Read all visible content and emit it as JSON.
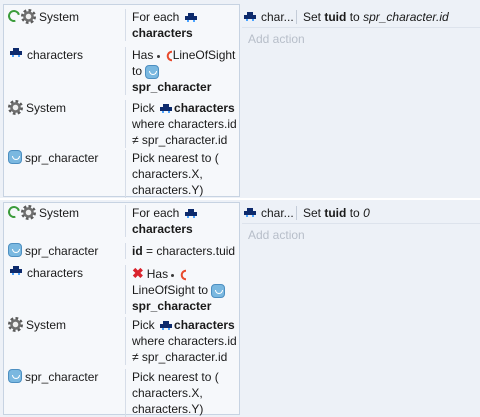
{
  "events": [
    {
      "conditions": [
        {
          "object_label": "System",
          "object_icons": [
            "loop-icon",
            "gear-icon"
          ],
          "text": {
            "prefix": "For each",
            "object": "characters"
          }
        },
        {
          "object_label": "characters",
          "object_icons": [
            "invader-icon"
          ],
          "text": {
            "prefix": "Has",
            "condition_name": "LineOfSight",
            "to_word": "to",
            "target": "spr_character"
          }
        },
        {
          "object_label": "System",
          "object_icons": [
            "gear-icon"
          ],
          "text": {
            "prefix": "Pick",
            "object": "characters",
            "line2": "where characters.id",
            "line3": "≠ spr_character.id"
          }
        },
        {
          "object_label": "spr_character",
          "object_icons": [
            "sprite-icon"
          ],
          "text": {
            "line1": "Pick nearest to (",
            "line2": "characters.X,",
            "line3": "characters.Y)"
          }
        }
      ],
      "action": {
        "object_label": "char...",
        "text_prefix": "Set",
        "variable": "tuid",
        "text_mid": "to",
        "value": "spr_character.id"
      },
      "add_action_label": "Add action"
    },
    {
      "conditions": [
        {
          "object_label": "System",
          "object_icons": [
            "loop-icon",
            "gear-icon"
          ],
          "text": {
            "prefix": "For each",
            "object": "characters"
          }
        },
        {
          "object_label": "spr_character",
          "object_icons": [
            "sprite-icon"
          ],
          "text": {
            "variable": "id",
            "operator": "=",
            "value": "characters.tuid"
          }
        },
        {
          "object_label": "characters",
          "object_icons": [
            "invader-icon"
          ],
          "inverted": true,
          "text": {
            "prefix": "Has",
            "condition_name": "LineOfSight",
            "to_word": "to",
            "target": "spr_character"
          }
        },
        {
          "object_label": "System",
          "object_icons": [
            "gear-icon"
          ],
          "text": {
            "prefix": "Pick",
            "object": "characters",
            "line2": "where characters.id",
            "line3": "≠ spr_character.id"
          }
        },
        {
          "object_label": "spr_character",
          "object_icons": [
            "sprite-icon"
          ],
          "text": {
            "line1": "Pick nearest to (",
            "line2": "characters.X,",
            "line3": "characters.Y)"
          }
        }
      ],
      "action": {
        "object_label": "char...",
        "text_prefix": "Set",
        "variable": "tuid",
        "text_mid": "to",
        "value": "0"
      },
      "add_action_label": "Add action"
    }
  ],
  "colors": {
    "event_background": "#edf1f7",
    "condition_background": "#f6f8fb",
    "inverted_marker": "#d9232d",
    "add_action_text": "#b7bec9"
  }
}
